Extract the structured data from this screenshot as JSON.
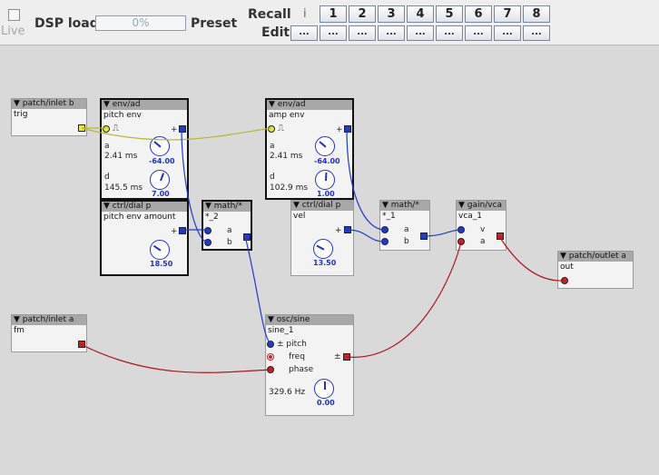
{
  "toolbar": {
    "live_label": "Live",
    "dsp_label": "DSP load",
    "dsp_value": "0%",
    "preset_label": "Preset",
    "recall_label": "Recall",
    "recall_info": "i",
    "edit_label": "Edit",
    "preset_buttons": [
      "1",
      "2",
      "3",
      "4",
      "5",
      "6",
      "7",
      "8"
    ],
    "edit_button_label": "..."
  },
  "objects": {
    "inlet_b": {
      "header": "▼ patch/inlet b",
      "instance": "trig"
    },
    "env1": {
      "header": "▼ env/ad",
      "instance": "pitch env",
      "a_label": "a",
      "a_value": "2.41 ms",
      "a_knob": "-64.00",
      "d_label": "d",
      "d_value": "145.5 ms",
      "d_knob": "7.00",
      "out_sign": "+"
    },
    "env2": {
      "header": "▼ env/ad",
      "instance": "amp env",
      "a_label": "a",
      "a_value": "2.41 ms",
      "a_knob": "-64.00",
      "d_label": "d",
      "d_value": "102.9 ms",
      "d_knob": "1.00",
      "out_sign": "+"
    },
    "dial1": {
      "header": "▼ ctrl/dial p",
      "instance": "pitch env amount",
      "value": "18.50",
      "out_sign": "+"
    },
    "mult2": {
      "header": "▼ math/*",
      "instance": "*_2",
      "in_a": "a",
      "in_b": "b"
    },
    "dial2": {
      "header": "▼ ctrl/dial p",
      "instance": "vel",
      "value": "13.50",
      "out_sign": "+"
    },
    "mult1": {
      "header": "▼ math/*",
      "instance": "*_1",
      "in_a": "a",
      "in_b": "b"
    },
    "vca": {
      "header": "▼ gain/vca",
      "instance": "vca_1",
      "in_v": "v",
      "in_a": "a"
    },
    "outlet_a": {
      "header": "▼ patch/outlet a",
      "instance": "out"
    },
    "inlet_a": {
      "header": "▼ patch/inlet a",
      "instance": "fm"
    },
    "sine": {
      "header": "▼ osc/sine",
      "instance": "sine_1",
      "in_pitch": "± pitch",
      "in_freq": "freq",
      "in_phase": "phase",
      "out_sign": "±",
      "freq_value": "329.6 Hz",
      "knob_value": "0.00"
    }
  },
  "colors": {
    "blue_wire": "#1c3bd6",
    "red_wire": "#b01818",
    "yellow_wire": "#b8b82a",
    "canvas_bg": "#d9d9d9",
    "header_bg": "#a8a8a8",
    "value_text": "#1f2fd0"
  }
}
